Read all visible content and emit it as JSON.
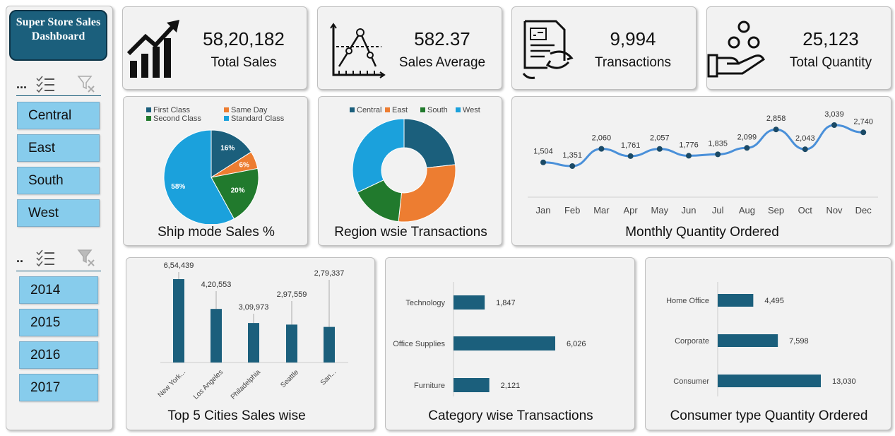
{
  "sidebar": {
    "title": "Super Store Sales Dashboard",
    "region_slicer": {
      "header": "...",
      "items": [
        "Central",
        "East",
        "South",
        "West"
      ]
    },
    "year_slicer": {
      "header": "..",
      "items": [
        "2014",
        "2015",
        "2016",
        "2017"
      ]
    }
  },
  "kpis": [
    {
      "value": "58,20,182",
      "label": "Total Sales",
      "icon": "growth-chart-icon"
    },
    {
      "value": "582.37",
      "label": "Sales Average",
      "icon": "line-graph-icon"
    },
    {
      "value": "9,994",
      "label": "Transactions",
      "icon": "invoice-exchange-icon"
    },
    {
      "value": "25,123",
      "label": "Total Quantity",
      "icon": "hand-coins-icon"
    }
  ],
  "colors": {
    "dark_blue": "#1b5f7c",
    "orange": "#ed7d31",
    "green": "#217a2d",
    "light_blue": "#1ba1dc",
    "line": "#4a90d9"
  },
  "chart_data": [
    {
      "type": "pie",
      "title": "Ship mode Sales %",
      "legend_placement": "top",
      "categories": [
        "First Class",
        "Same Day",
        "Second Class",
        "Standard Class"
      ],
      "values": [
        16,
        6,
        20,
        58
      ],
      "value_labels": [
        "16%",
        "6%",
        "20%",
        "58%"
      ]
    },
    {
      "type": "pie",
      "variant": "donut",
      "title": "Region wsie Transactions",
      "legend_placement": "top",
      "categories": [
        "Central",
        "East",
        "South",
        "West"
      ],
      "values": [
        2323,
        2848,
        1620,
        3203
      ]
    },
    {
      "type": "line",
      "title": "Monthly Quantity Ordered",
      "categories": [
        "Jan",
        "Feb",
        "Mar",
        "Apr",
        "May",
        "Jun",
        "Jul",
        "Aug",
        "Sep",
        "Oct",
        "Nov",
        "Dec"
      ],
      "values": [
        1504,
        1351,
        2060,
        1761,
        2057,
        1776,
        1835,
        2099,
        2858,
        2043,
        3039,
        2740
      ],
      "value_labels": [
        "1,504",
        "1,351",
        "2,060",
        "1,761",
        "2,057",
        "1,776",
        "1,835",
        "2,099",
        "2,858",
        "2,043",
        "3,039",
        "2,740"
      ],
      "grid": false
    },
    {
      "type": "bar",
      "title": "Top 5 Cities Sales wise",
      "categories": [
        "New York...",
        "Los Angeles",
        "Philadelphia",
        "Seattle",
        "San..."
      ],
      "values": [
        654439,
        420553,
        309973,
        297559,
        279337
      ],
      "value_labels": [
        "6,54,439",
        "4,20,553",
        "3,09,973",
        "2,97,559",
        "2,79,337"
      ]
    },
    {
      "type": "bar",
      "orientation": "horizontal",
      "title": "Category wise Transactions",
      "categories": [
        "Technology",
        "Office Supplies",
        "Furniture"
      ],
      "values": [
        1847,
        6026,
        2121
      ],
      "value_labels": [
        "1,847",
        "6,026",
        "2,121"
      ]
    },
    {
      "type": "bar",
      "orientation": "horizontal",
      "title": "Consumer type Quantity Ordered",
      "categories": [
        "Home Office",
        "Corporate",
        "Consumer"
      ],
      "values": [
        4495,
        7598,
        13030
      ],
      "value_labels": [
        "4,495",
        "7,598",
        "13,030"
      ]
    }
  ]
}
